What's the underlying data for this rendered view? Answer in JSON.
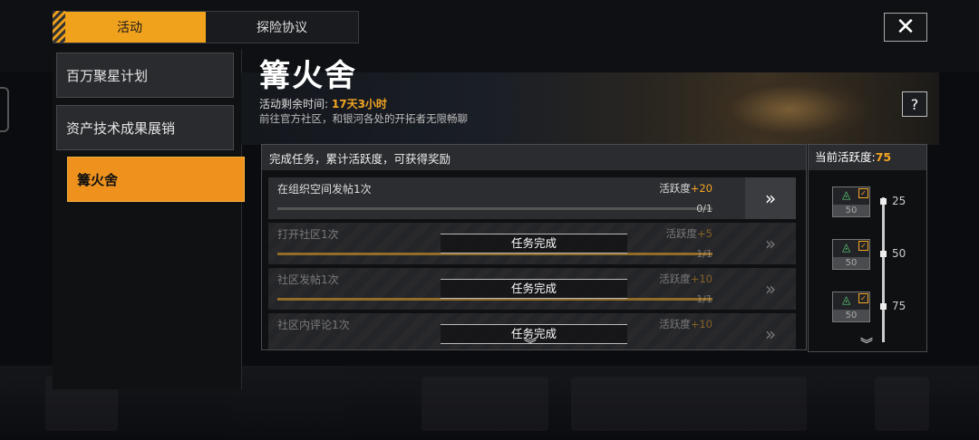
{
  "tabs": [
    {
      "label": "活动",
      "active": true
    },
    {
      "label": "探险协议",
      "active": false
    }
  ],
  "close_label": "✕",
  "menu": [
    {
      "label": "百万聚星计划"
    },
    {
      "label": "资产技术成果展销"
    },
    {
      "label": "篝火舍"
    }
  ],
  "event": {
    "title": "篝火舍",
    "remaining_label": "活动剩余时间:",
    "remaining_value": "17天3小时",
    "description": "前往官方社区，和银河各处的开拓者无限畅聊",
    "help_label": "?"
  },
  "tasks_panel": {
    "header": "完成任务，累计活跃度，可获得奖励",
    "tasks": [
      {
        "name": "在组织空间发帖1次",
        "activity_label": "活跃度",
        "activity_value": "+20",
        "progress": "0/1",
        "progress_fraction": 0,
        "status": "",
        "go": "»"
      },
      {
        "name": "打开社区1次",
        "activity_label": "活跃度",
        "activity_value": "+5",
        "progress": "1/1",
        "progress_fraction": 1,
        "status": "任务完成",
        "go": "»"
      },
      {
        "name": "社区发帖1次",
        "activity_label": "活跃度",
        "activity_value": "+10",
        "progress": "1/1",
        "progress_fraction": 1,
        "status": "任务完成",
        "go": "»"
      },
      {
        "name": "社区内评论1次",
        "activity_label": "活跃度",
        "activity_value": "+10",
        "progress": "",
        "progress_fraction": 1,
        "status": "任务完成",
        "go": "»"
      }
    ],
    "more_icon": "chevron-down"
  },
  "activity_panel": {
    "label": "当前活跃度:",
    "value": "75",
    "milestones": [
      {
        "level": "25",
        "reward_count": "50"
      },
      {
        "level": "50",
        "reward_count": "50"
      },
      {
        "level": "75",
        "reward_count": "50"
      }
    ],
    "more_icon": "chevron-down"
  },
  "colors": {
    "accent": "#f1a21c",
    "highlight": "#f4a623",
    "menu_active": "#ee921d"
  }
}
